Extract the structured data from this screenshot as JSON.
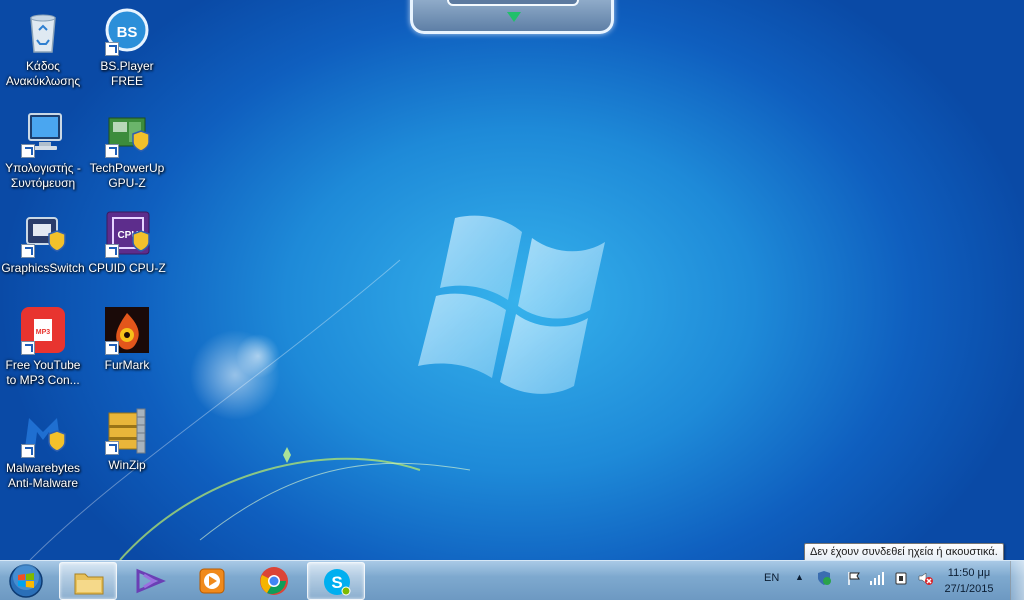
{
  "desktop": {
    "icons": [
      {
        "label": "Κάδος Ανακύκλωσης",
        "icon": "recycle-bin-icon"
      },
      {
        "label": "BS.Player FREE",
        "icon": "bsplayer-icon"
      },
      {
        "label": "Υπολογιστής - Συντόμευση",
        "icon": "computer-icon"
      },
      {
        "label": "TechPowerUp GPU-Z",
        "icon": "gpuz-icon"
      },
      {
        "label": "GraphicsSwitch",
        "icon": "graphicsswitch-icon"
      },
      {
        "label": "CPUID CPU-Z",
        "icon": "cpuz-icon"
      },
      {
        "label": "Free YouTube to MP3 Con...",
        "icon": "youtube-mp3-icon"
      },
      {
        "label": "FurMark",
        "icon": "furmark-icon"
      },
      {
        "label": "Malwarebytes Anti-Malware",
        "icon": "malwarebytes-icon"
      },
      {
        "label": "WinZip",
        "icon": "winzip-icon"
      }
    ]
  },
  "taskbar": {
    "pinned": [
      {
        "name": "file-explorer",
        "icon": "folder-icon",
        "active": true
      },
      {
        "name": "visual-studio",
        "icon": "visual-studio-icon",
        "active": false
      },
      {
        "name": "media-player",
        "icon": "media-player-icon",
        "active": false
      },
      {
        "name": "chrome",
        "icon": "chrome-icon",
        "active": false
      },
      {
        "name": "skype",
        "icon": "skype-icon",
        "active": true
      }
    ],
    "tray": {
      "language": "EN",
      "clock_time": "11:50 μμ",
      "clock_date": "27/1/2015",
      "tooltip": "Δεν έχουν συνδεθεί ηχεία ή ακουστικά."
    }
  },
  "colors": {
    "accent": "#1e8ad8",
    "taskbar": "#7ea9cf"
  }
}
